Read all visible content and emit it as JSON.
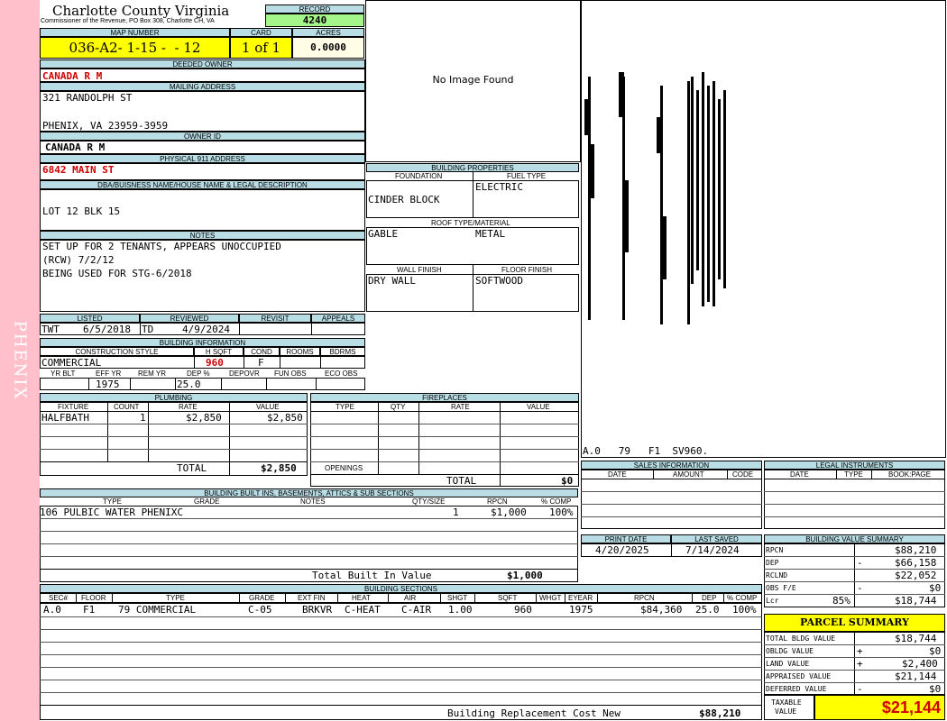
{
  "side_label": "PHENIX",
  "header": {
    "county": "Charlotte County Virginia",
    "commissioner": "Commissioner of the Revenue, PO Box 308, Charlotte CH, VA",
    "record_label": "RECORD",
    "record": "4240"
  },
  "map": {
    "map_label": "MAP NUMBER",
    "map": "036-A2- 1-15 -  - 12",
    "card_label": "CARD",
    "card": "1 of 1",
    "acres_label": "ACRES",
    "acres": "0.0000"
  },
  "owner": {
    "deeded_label": "DEEDED OWNER",
    "deeded": "CANADA R M",
    "mailing_label": "MAILING ADDRESS",
    "addr1": "321 RANDOLPH ST",
    "addr2": "PHENIX, VA 23959-3959",
    "id_label": "OWNER ID",
    "id": "CANADA R M",
    "phys_label": "PHYSICAL 911 ADDRESS",
    "phys": "6842 MAIN ST"
  },
  "legal": {
    "label": "DBA/BUISNESS NAME/HOUSE NAME & LEGAL DESCRIPTION",
    "text": "LOT 12 BLK 15"
  },
  "notes": {
    "label": "NOTES",
    "l1": "SET UP FOR 2 TENANTS, APPEARS UNOCCUPIED",
    "l2": "(RCW) 7/2/12",
    "l3": "BEING USED FOR STG-6/2018"
  },
  "listing": {
    "listed_label": "LISTED",
    "reviewed_label": "REVIEWED",
    "revisit_label": "REVISIT",
    "appeals_label": "APPEALS",
    "lister": "TWT",
    "listed": "6/5/2018",
    "reviewer": "TD",
    "reviewed": "4/9/2024"
  },
  "bldg_info": {
    "label": "BUILDING INFORMATION",
    "cs_label": "CONSTRUCTION STYLE",
    "hsqft_label": "H SQFT",
    "cond_label": "COND",
    "rooms_label": "ROOMS",
    "bdrms_label": "BDRMS",
    "style": "COMMERCIAL",
    "hsqft": "960",
    "cond": "F",
    "yrblt_label": "YR BLT",
    "effyr_label": "EFF YR",
    "remyr_label": "REM YR",
    "dep_label": "DEP %",
    "depovr_label": "DEPOVR",
    "funobs_label": "FUN OBS",
    "ecoobs_label": "ECO OBS",
    "effyr": "1975",
    "dep": "25.0"
  },
  "plumbing": {
    "label": "PLUMBING",
    "h_fixture": "FIXTURE",
    "h_count": "COUNT",
    "h_rate": "RATE",
    "h_value": "VALUE",
    "fixture": "HALFBATH",
    "count": "1",
    "rate": "$2,850",
    "value": "$2,850",
    "total_label": "TOTAL",
    "total": "$2,850"
  },
  "fireplaces": {
    "label": "FIREPLACES",
    "h_type": "TYPE",
    "h_qty": "QTY",
    "h_rate": "RATE",
    "h_value": "VALUE",
    "openings": "OPENINGS",
    "total_label": "TOTAL",
    "total": "$0"
  },
  "image": {
    "no_image": "No Image Found"
  },
  "bprops": {
    "label": "BUILDING PROPERTIES",
    "foundation_label": "FOUNDATION",
    "fuel_label": "FUEL TYPE",
    "foundation": "CINDER BLOCK",
    "fuel": "ELECTRIC",
    "roof_label": "ROOF TYPE/MATERIAL",
    "roof_type": "GABLE",
    "roof_material": "METAL",
    "wall_label": "WALL FINISH",
    "floor_label": "FLOOR FINISH",
    "wall": "DRY WALL",
    "floor": "SOFTWOOD"
  },
  "sketch": {
    "caption": "A.0   79   F1  SV960."
  },
  "sales": {
    "label": "SALES INFORMATION",
    "date": "DATE",
    "amount": "AMOUNT",
    "code": "CODE"
  },
  "legal_instr": {
    "label": "LEGAL INSTRUMENTS",
    "date": "DATE",
    "type": "TYPE",
    "bookpage": "BOOK:PAGE"
  },
  "dates": {
    "print_label": "PRINT DATE",
    "saved_label": "LAST SAVED",
    "print": "4/20/2025",
    "saved": "7/14/2024"
  },
  "builtins": {
    "label": "BUILDING BUILT INS, BASEMENTS, ATTICS & SUB SECTIONS",
    "h_type": "TYPE",
    "h_grade": "GRADE",
    "h_notes": "NOTES",
    "h_qty": "QTY/SIZE",
    "h_rpcn": "RPCN",
    "h_comp": "% COMP",
    "type": "106 PULBIC WATER PHENIXC",
    "qty": "1",
    "rpcn": "$1,000",
    "comp": "100%",
    "total_label": "Total Built In Value",
    "total": "$1,000"
  },
  "sections": {
    "label": "BUILDING SECTIONS",
    "h_sec": "SEC#",
    "h_floor": "FLOOR",
    "h_type": "TYPE",
    "h_grade": "GRADE",
    "h_extfin": "EXT FIN",
    "h_heat": "HEAT",
    "h_air": "AIR",
    "h_shgt": "SHGT",
    "h_sqft": "SQFT",
    "h_whgt": "WHGT",
    "h_eyear": "EYEAR",
    "h_rpcn": "RPCN",
    "h_dep": "DEP",
    "h_comp": "% COMP",
    "sec": "A.0",
    "floor": "F1",
    "type": "79 COMMERCIAL",
    "grade": "C-05",
    "extfin": "BRKVR",
    "heat": "C-HEAT",
    "air": "C-AIR",
    "shgt": "1.00",
    "sqft": "960",
    "eyear": "1975",
    "rpcn": "$84,360",
    "dep": "25.0",
    "comp": "100%",
    "brcn_label": "Building Replacement Cost New",
    "brcn": "$88,210"
  },
  "value_summary": {
    "label": "BUILDING VALUE SUMMARY",
    "rpcn_l": "RPCN",
    "rpcn": "$88,210",
    "dep_l": "DEP",
    "dep_sign": "-",
    "dep": "$66,158",
    "rclnd_l": "RCLND",
    "rclnd": "$22,052",
    "obs_l": "OBS F/E",
    "obs_sign": "-",
    "obs": "$0",
    "lcr_l": "Lcr",
    "lcr_pct": "85%",
    "lcr": "$18,744"
  },
  "parcel": {
    "label": "PARCEL SUMMARY",
    "bldg_l": "TOTAL BLDG VALUE",
    "bldg": "$18,744",
    "obldg_l": "OBLDG VALUE",
    "obldg_sign": "+",
    "obldg": "$0",
    "land_l": "LAND VALUE",
    "land_sign": "+",
    "land": "$2,400",
    "appr_l": "APPRAISED VALUE",
    "appr": "$21,144",
    "def_l": "DEFERRED VALUE",
    "def_sign": "-",
    "def": "$0",
    "tax_l1": "TAXABLE",
    "tax_l2": "VALUE",
    "tax": "$21,144"
  },
  "colors": {
    "sidebar": "#ffc0cb",
    "header_band": "#b8dde4",
    "yellow": "#ffff00",
    "green": "#a4f58a",
    "red": "#d00000"
  }
}
